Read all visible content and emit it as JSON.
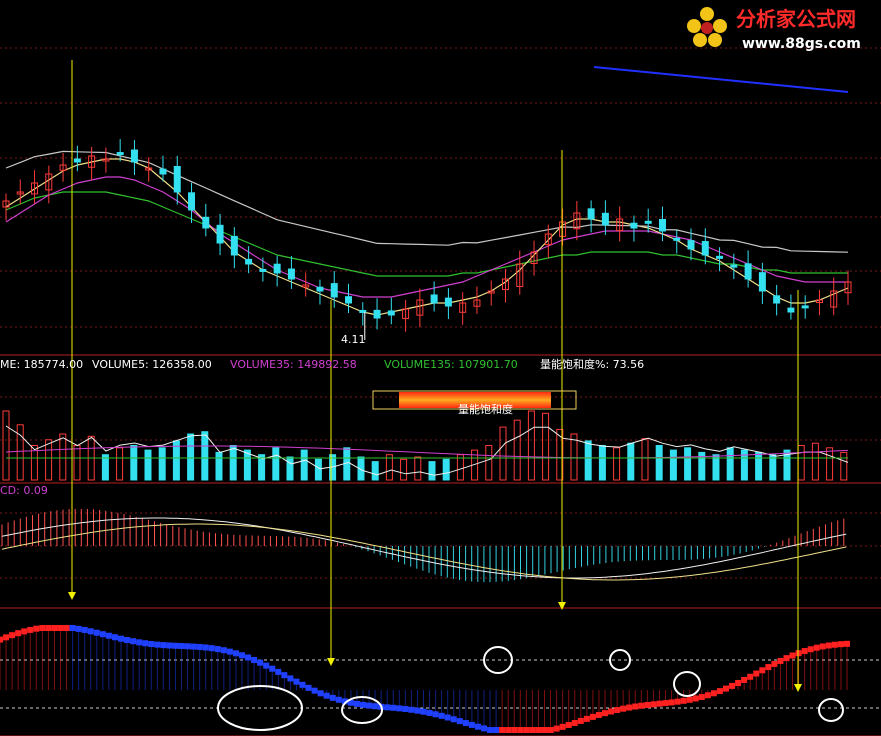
{
  "logo": {
    "name": "分析家公式网",
    "url": "www.88gs.com",
    "colors": {
      "text": "#ff2a2a",
      "url": "#ffffff",
      "flower": "#f2c418"
    }
  },
  "price_panel": {
    "low_marker": "4.11",
    "colors": {
      "up": "#ff3b3b",
      "down": "#33e0f0",
      "ma5": "#f0f0f0",
      "ma10": "#f0e08a",
      "ma30": "#d040d0",
      "ma60": "#30c030",
      "ma120": "#c8c8c8",
      "trend": "#2030ff"
    }
  },
  "volume_panel": {
    "legend": [
      {
        "text": "ME: 185774.00",
        "color": "#ffffff"
      },
      {
        "text": "VOLUME5: 126358.00",
        "color": "#ffffff"
      },
      {
        "text": "VOLUME35: 149892.58",
        "color": "#d040d0"
      },
      {
        "text": "VOLUME135: 107901.70",
        "color": "#30c030"
      },
      {
        "text": "量能饱和度%: 73.56",
        "color": "#ffffff"
      }
    ],
    "saturation_label": "量能饱和度",
    "saturation_percent": 73.56
  },
  "macd_panel": {
    "legend": "CD: 0.09"
  },
  "chart_data": {
    "type": "candlestick",
    "price": {
      "low": 4.11,
      "close": [
        8.3,
        8.6,
        8.9,
        9.2,
        9.5,
        9.6,
        9.8,
        9.7,
        9.9,
        9.6,
        9.4,
        9.2,
        8.6,
        8.0,
        7.4,
        6.9,
        6.5,
        6.2,
        6.0,
        5.9,
        5.7,
        5.5,
        5.3,
        5.1,
        4.9,
        4.6,
        4.4,
        4.5,
        4.7,
        5.0,
        4.9,
        4.8,
        4.9,
        5.0,
        5.3,
        5.7,
        6.2,
        6.6,
        7.2,
        7.6,
        7.9,
        7.7,
        7.5,
        7.7,
        7.4,
        7.6,
        7.3,
        7.0,
        6.7,
        6.5,
        6.4,
        6.1,
        5.7,
        5.3,
        4.9,
        4.6,
        4.8,
        5.0,
        5.3,
        5.6
      ],
      "ma5": [
        8.1,
        8.4,
        8.7,
        9.0,
        9.3,
        9.5,
        9.6,
        9.7,
        9.7,
        9.6,
        9.4,
        9.0,
        8.6,
        8.1,
        7.6,
        7.1,
        6.6,
        6.3,
        6.0,
        5.8,
        5.6,
        5.4,
        5.2,
        5.0,
        4.8,
        4.6,
        4.5,
        4.6,
        4.7,
        4.8,
        4.9,
        4.9,
        5.0,
        5.1,
        5.3,
        5.6,
        6.0,
        6.5,
        7.0,
        7.5,
        7.7,
        7.7,
        7.6,
        7.6,
        7.5,
        7.4,
        7.2,
        7.0,
        6.7,
        6.5,
        6.3,
        6.0,
        5.7,
        5.4,
        5.1,
        4.9,
        4.9,
        5.0,
        5.2,
        5.4
      ],
      "ma30": [
        7.6,
        7.9,
        8.2,
        8.5,
        8.7,
        8.9,
        9.0,
        9.1,
        9.1,
        9.0,
        8.8,
        8.6,
        8.3,
        8.0,
        7.6,
        7.2,
        6.9,
        6.6,
        6.3,
        6.0,
        5.8,
        5.6,
        5.4,
        5.3,
        5.2,
        5.1,
        5.1,
        5.1,
        5.2,
        5.3,
        5.4,
        5.5,
        5.6,
        5.8,
        6.0,
        6.2,
        6.4,
        6.6,
        6.8,
        7.0,
        7.1,
        7.2,
        7.3,
        7.3,
        7.3,
        7.3,
        7.2,
        7.1,
        7.0,
        6.8,
        6.6,
        6.4,
        6.2,
        6.0,
        5.8,
        5.7,
        5.6,
        5.6,
        5.6,
        5.6
      ],
      "ma60": [
        8.0,
        8.2,
        8.4,
        8.5,
        8.6,
        8.6,
        8.6,
        8.6,
        8.5,
        8.4,
        8.3,
        8.1,
        7.9,
        7.7,
        7.5,
        7.3,
        7.1,
        6.9,
        6.7,
        6.5,
        6.4,
        6.3,
        6.2,
        6.1,
        6.0,
        5.9,
        5.8,
        5.8,
        5.8,
        5.8,
        5.8,
        5.8,
        5.9,
        5.9,
        6.0,
        6.1,
        6.2,
        6.3,
        6.4,
        6.5,
        6.5,
        6.6,
        6.6,
        6.6,
        6.6,
        6.6,
        6.5,
        6.5,
        6.4,
        6.3,
        6.2,
        6.2,
        6.1,
        6.0,
        6.0,
        5.9,
        5.9,
        5.9,
        5.9,
        5.9
      ]
    },
    "volume": {
      "legend": [
        "ME",
        "VOLUME5",
        "VOLUME35",
        "VOLUME135",
        "量能饱和度%"
      ],
      "values": [
        185774.0,
        126358.0,
        149892.58,
        107901.7,
        73.56
      ]
    },
    "macd": {
      "value": 0.09
    }
  }
}
